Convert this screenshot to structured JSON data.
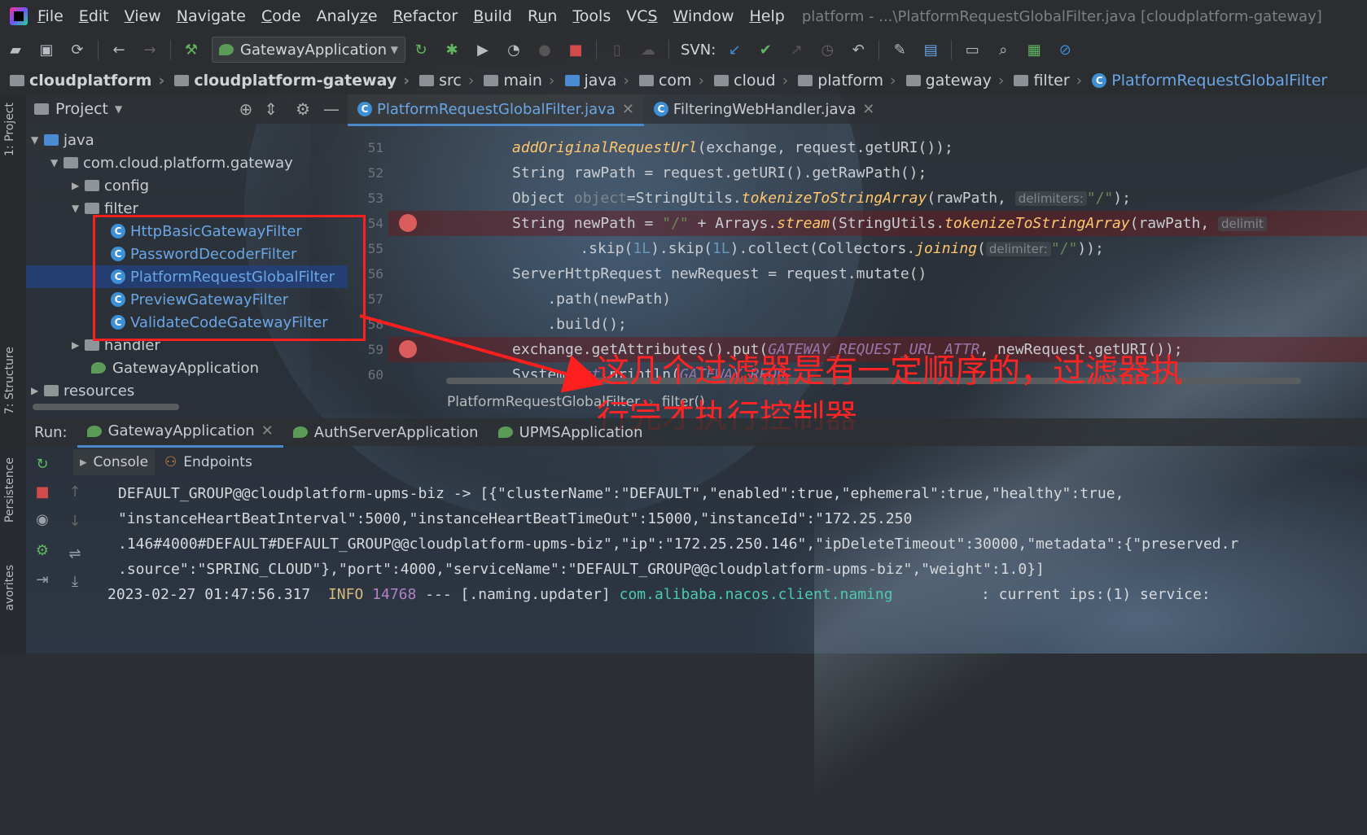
{
  "window": {
    "title": "platform - ...\\PlatformRequestGlobalFilter.java [cloudplatform-gateway]"
  },
  "menu": [
    {
      "pre": "",
      "u": "F",
      "post": "ile"
    },
    {
      "pre": "",
      "u": "E",
      "post": "dit"
    },
    {
      "pre": "",
      "u": "V",
      "post": "iew"
    },
    {
      "pre": "",
      "u": "N",
      "post": "avigate"
    },
    {
      "pre": "",
      "u": "C",
      "post": "ode"
    },
    {
      "pre": "Analy",
      "u": "z",
      "post": "e"
    },
    {
      "pre": "",
      "u": "R",
      "post": "efactor"
    },
    {
      "pre": "",
      "u": "B",
      "post": "uild"
    },
    {
      "pre": "R",
      "u": "u",
      "post": "n"
    },
    {
      "pre": "",
      "u": "T",
      "post": "ools"
    },
    {
      "pre": "VC",
      "u": "S",
      "post": ""
    },
    {
      "pre": "",
      "u": "W",
      "post": "indow"
    },
    {
      "pre": "",
      "u": "H",
      "post": "elp"
    }
  ],
  "toolbar": {
    "run_config": "GatewayApplication",
    "svn_label": "SVN:"
  },
  "breadcrumb": [
    "cloudplatform",
    "cloudplatform-gateway",
    "src",
    "main",
    "java",
    "com",
    "cloud",
    "platform",
    "gateway",
    "filter",
    "PlatformRequestGlobalFilter"
  ],
  "left_strip": {
    "project": "1: Project",
    "structure": "7: Structure",
    "persistence": "Persistence",
    "favorites": "avorites"
  },
  "project": {
    "title": "Project",
    "tree": {
      "java": "java",
      "pkg": "com.cloud.platform.gateway",
      "config": "config",
      "filter": "filter",
      "c1": "HttpBasicGatewayFilter",
      "c2": "PasswordDecoderFilter",
      "c3": "PlatformRequestGlobalFilter",
      "c4": "PreviewGatewayFilter",
      "c5": "ValidateCodeGatewayFilter",
      "handler": "handler",
      "app": "GatewayApplication",
      "resources": "resources"
    }
  },
  "editor": {
    "tabs": [
      "PlatformRequestGlobalFilter.java",
      "FilteringWebHandler.java"
    ],
    "lines": [
      "51",
      "52",
      "53",
      "54",
      "55",
      "56",
      "57",
      "58",
      "59",
      "60"
    ],
    "status_class": "PlatformRequestGlobalFilter",
    "status_method": "filter()",
    "code": {
      "l51a": "addOriginalRequestUrl",
      "l51b": "(exchange, request.getURI());",
      "l52a": "String rawPath = request.getURI().getRawPath();",
      "l53a": "Object ",
      "l53b": "object",
      "l53c": "=StringUtils.",
      "l53d": "tokenizeToStringArray",
      "l53e": "(rawPath, ",
      "l53hint": "delimiters:",
      "l53f": "\"/\"",
      "l53g": ");",
      "l54a": "String newPath = ",
      "l54b": "\"/\"",
      "l54c": " + Arrays.",
      "l54d": "stream",
      "l54e": "(StringUtils.",
      "l54f": "tokenizeToStringArray",
      "l54g": "(rawPath, ",
      "l54hint": "delimit",
      "l55a": "    .skip(",
      "l55b": "1L",
      "l55c": ").skip(",
      "l55d": "1L",
      "l55e": ").collect(Collectors.",
      "l55f": "joining",
      "l55g": "(",
      "l55hint": "delimiter:",
      "l55h": "\"/\"",
      "l55i": "));",
      "l56a": "ServerHttpRequest newRequest = request.mutate()",
      "l57a": "    .path(newPath)",
      "l58a": "    .build();",
      "l59a": "exchange.getAttributes().put(",
      "l59b": "GATEWAY_REQUEST_URL_ATTR",
      "l59c": ", newRequest.getURI());",
      "l60a": "System.",
      "l60b": "out",
      "l60c": ".println(",
      "l60d": "GATEWAY_REQU"
    }
  },
  "annotation": {
    "line1": "这几个过滤器是有一定顺序的，过滤器执",
    "line2": "行完才执行控制器"
  },
  "run": {
    "label": "Run:",
    "tabs": [
      "GatewayApplication",
      "AuthServerApplication",
      "UPMSApplication"
    ],
    "subtabs": [
      "Console",
      "Endpoints"
    ],
    "console": {
      "l1": "DEFAULT_GROUP@@cloudplatform-upms-biz -> [{\"clusterName\":\"DEFAULT\",\"enabled\":true,\"ephemeral\":true,\"healthy\":true,",
      "l2": "\"instanceHeartBeatInterval\":5000,\"instanceHeartBeatTimeOut\":15000,\"instanceId\":\"172.25.250",
      "l3": ".146#4000#DEFAULT#DEFAULT_GROUP@@cloudplatform-upms-biz\",\"ip\":\"172.25.250.146\",\"ipDeleteTimeout\":30000,\"metadata\":{\"preserved.r",
      "l4": ".source\":\"SPRING_CLOUD\"},\"port\":4000,\"serviceName\":\"DEFAULT_GROUP@@cloudplatform-upms-biz\",\"weight\":1.0}]",
      "l5_time": "2023-02-27 01:47:56.317",
      "l5_level": "INFO",
      "l5_pid": "14768",
      "l5_sep": "---",
      "l5_thread": "[.naming.updater]",
      "l5_logger": "com.alibaba.nacos.client.naming",
      "l5_msg": ": current ips:(1) service:"
    }
  }
}
